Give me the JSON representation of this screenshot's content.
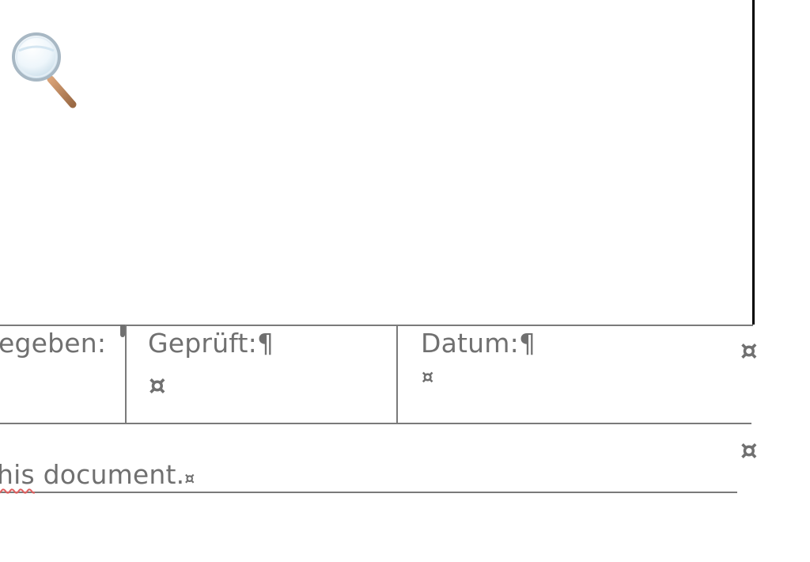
{
  "toolbar": {
    "zoom_icon": "magnifier-icon"
  },
  "signature_table": {
    "cells": [
      {
        "label": "egeben:",
        "end_mark": "¤"
      },
      {
        "label": "Geprüft:",
        "paragraph_mark": "¶",
        "end_mark": "¤"
      },
      {
        "label": "Datum:",
        "paragraph_mark": "¶",
        "end_mark": "¤"
      }
    ],
    "row_end_mark": "¤"
  },
  "footer_row": {
    "text_prefix": "his",
    "text_rest": " document.",
    "end_mark": "¤",
    "row_end_mark": "¤"
  },
  "colors": {
    "text_gray": "#707070",
    "line_gray": "#7a7a7a",
    "spell_red": "#e06060",
    "page_edge": "#000000"
  }
}
